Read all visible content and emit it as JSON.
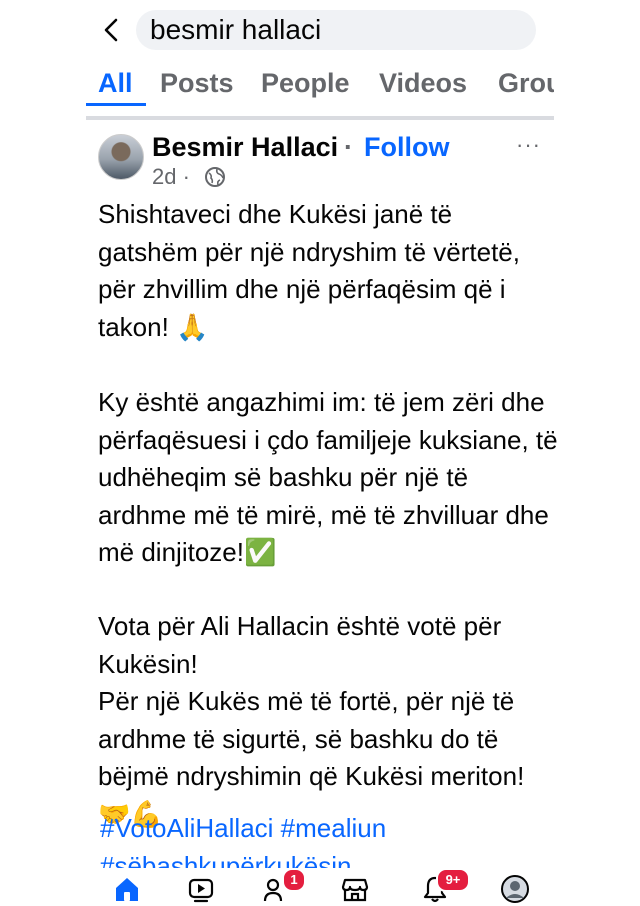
{
  "search": {
    "query": "besmir hallaci"
  },
  "tabs": [
    {
      "label": "All"
    },
    {
      "label": "Posts"
    },
    {
      "label": "People"
    },
    {
      "label": "Videos"
    },
    {
      "label": "Grou"
    }
  ],
  "post": {
    "author": "Besmir Hallaci",
    "separator": "·",
    "follow_label": "Follow",
    "more_label": "···",
    "time": "2d ·",
    "paragraphs": [
      "Shishtaveci dhe Kukësi janë të gatshëm për një ndryshim të vërtetë, për zhvillim dhe një përfaqësim që i takon! 🙏",
      "Ky është angazhimi im: të jem zëri dhe përfaqësuesi i çdo familjeje kuksiane, të udhëheqim së bashku për një të ardhme më të mirë, më të zhvilluar dhe më dinjitoze!✅",
      "Vota për Ali Hallacin është votë për Kukësin!",
      "Për një Kukës më të fortë, për një të ardhme të sigurtë, së bashku do të bëjmë ndryshimin që Kukësi meriton! 🤝💪"
    ],
    "hashtags": "#VotoAliHallaci #mealiun #sëbashkupërkukësin"
  },
  "nav": {
    "friends_badge": "1",
    "notifications_badge": "9+"
  },
  "colors": {
    "accent": "#0866ff",
    "badge": "#e41e3f",
    "muted": "#65676b"
  },
  "icons": [
    "back-arrow-icon",
    "globe-icon",
    "home-icon",
    "video-icon",
    "friends-icon",
    "marketplace-icon",
    "bell-icon",
    "profile-avatar"
  ]
}
